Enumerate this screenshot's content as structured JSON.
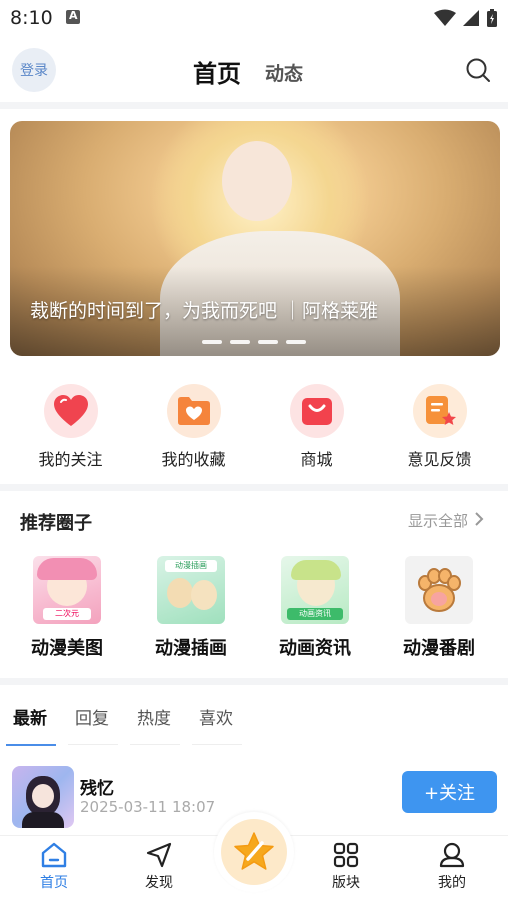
{
  "status": {
    "time": "8:10"
  },
  "header": {
    "login_label": "登录",
    "tabs": [
      {
        "label": "首页"
      },
      {
        "label": "动态"
      }
    ]
  },
  "banner": {
    "caption": "裁断的时间到了，为我而死吧 ｜阿格莱雅",
    "dot_count": 4
  },
  "quick_links": [
    {
      "label": "我的关注",
      "icon": "heart-icon",
      "color": "#f0444f"
    },
    {
      "label": "我的收藏",
      "icon": "folder-heart-icon",
      "color": "#f5843c"
    },
    {
      "label": "商城",
      "icon": "shopping-bag-icon",
      "color": "#f2424d"
    },
    {
      "label": "意见反馈",
      "icon": "feedback-icon",
      "color": "#f6913a"
    }
  ],
  "recommended": {
    "title": "推荐圈子",
    "more_label": "显示全部",
    "circles": [
      {
        "label": "动漫美图",
        "thumb_text": "二次元"
      },
      {
        "label": "动漫插画",
        "thumb_text": "动漫插画"
      },
      {
        "label": "动画资讯",
        "thumb_text": "动画资讯"
      },
      {
        "label": "动漫番剧",
        "thumb_text": ""
      }
    ]
  },
  "feed_tabs": [
    {
      "label": "最新"
    },
    {
      "label": "回复"
    },
    {
      "label": "热度"
    },
    {
      "label": "喜欢"
    }
  ],
  "post": {
    "author": "残忆",
    "time": "2025-03-11 18:07",
    "follow_label": "+关注"
  },
  "bottom_nav": [
    {
      "label": "首页",
      "icon": "home-icon",
      "active": true
    },
    {
      "label": "发现",
      "icon": "compass-icon"
    },
    {
      "label": "版块",
      "icon": "grid-icon"
    },
    {
      "label": "我的",
      "icon": "user-icon"
    }
  ],
  "colors": {
    "accent": "#3e95f0",
    "nav_active": "#2f7fe4"
  }
}
